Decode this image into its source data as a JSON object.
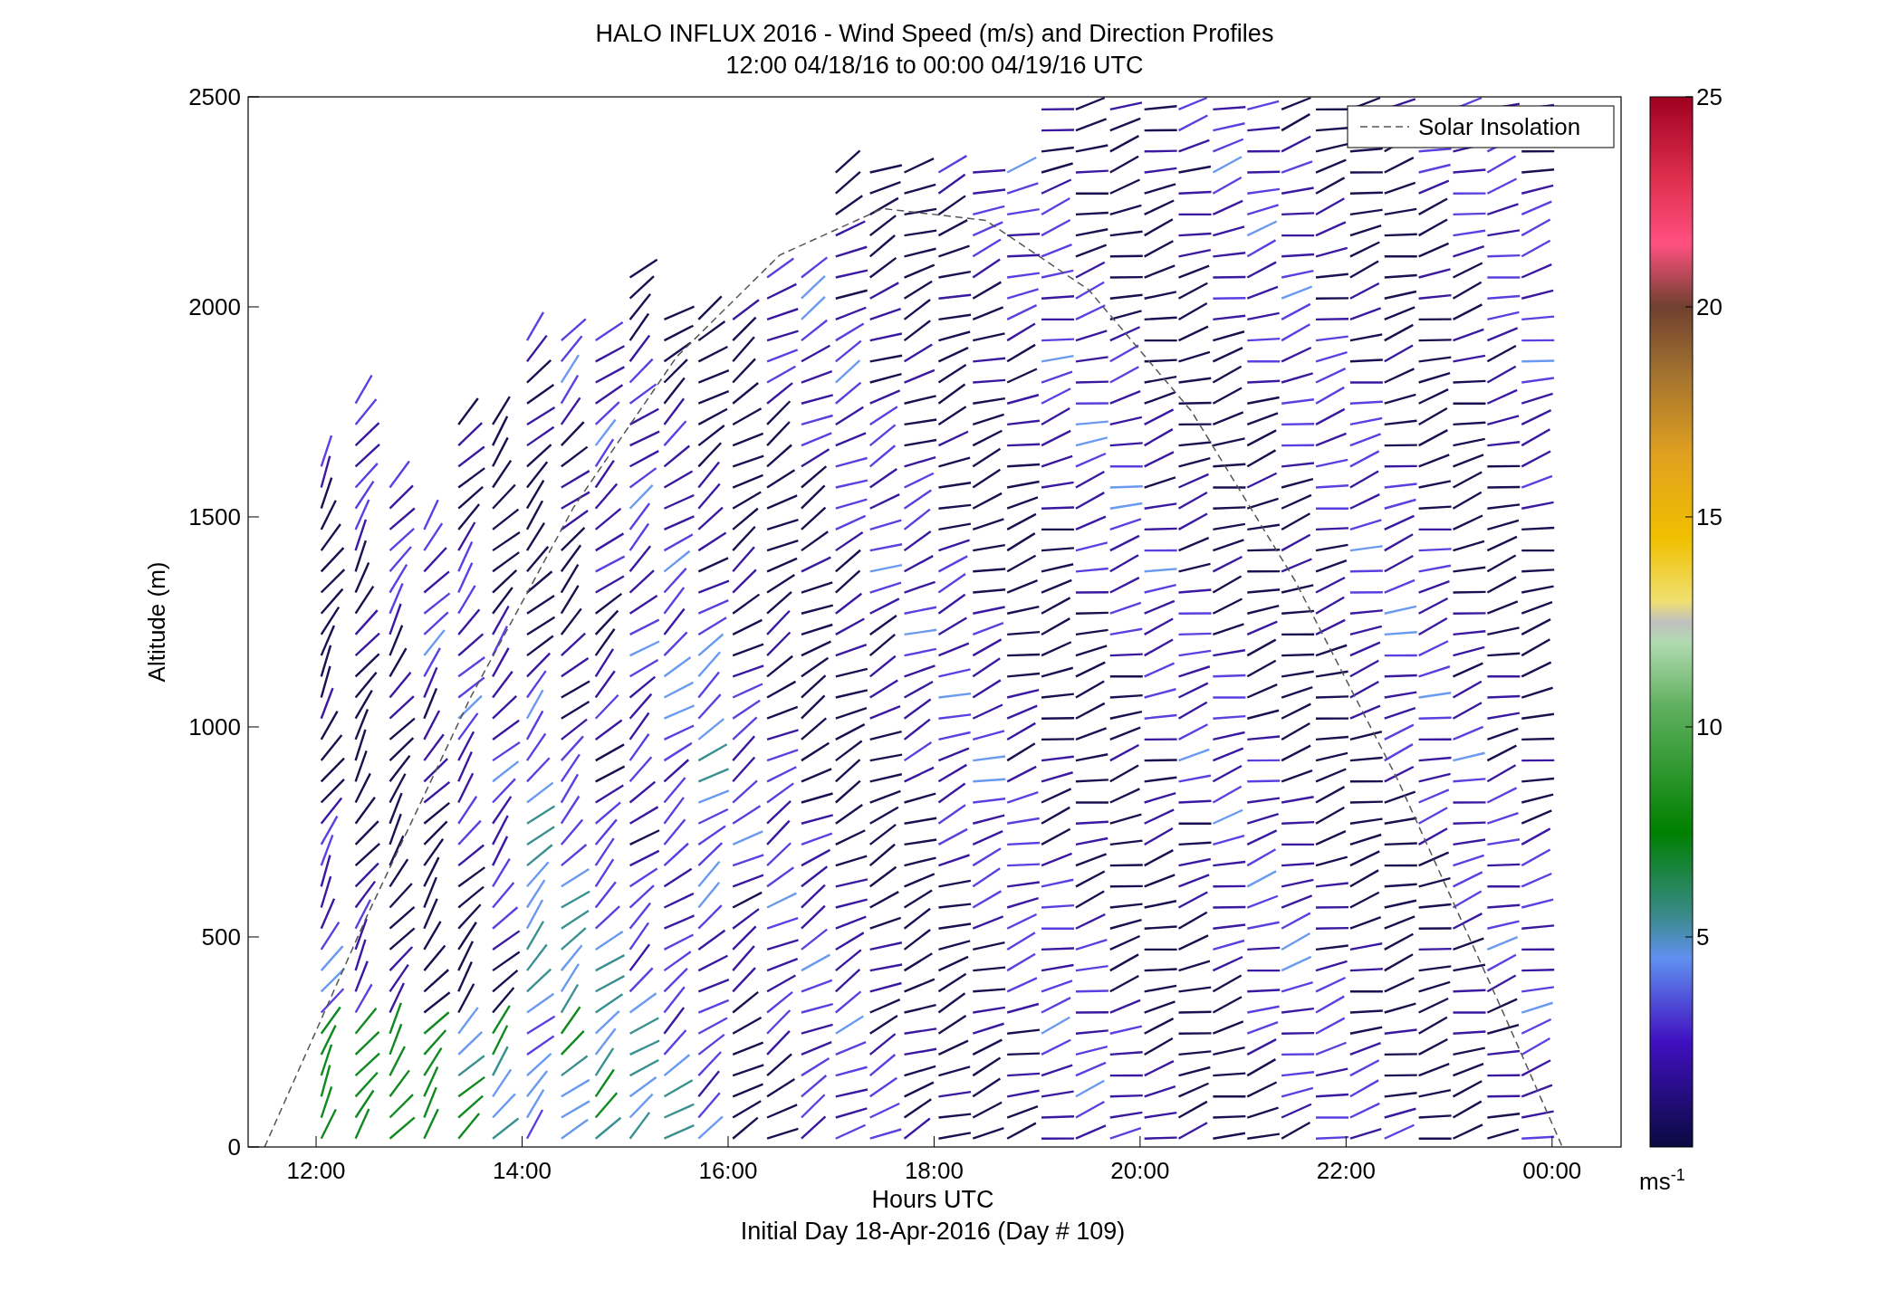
{
  "title": [
    "HALO INFLUX 2016 - Wind Speed (m/s) and Direction Profiles",
    "12:00 04/18/16 to 00:00 04/19/16  UTC"
  ],
  "plot": {
    "subtitle": "Initial Day 18-Apr-2016 (Day # 109)",
    "chart_data": {
      "type": "line",
      "xlabel": "Hours UTC",
      "ylabel": "Altitude (m)",
      "x": [
        11.5,
        12.5,
        13.5,
        14.5,
        15.5,
        16.5,
        17.5,
        18.5,
        19.5,
        20.5,
        21.5,
        22.5,
        23.5,
        24.1
      ],
      "series": [
        {
          "name": "Solar Insolation",
          "color": "#555555",
          "line_style": "dashed",
          "values": [
            0,
            553,
            1071,
            1523,
            1881,
            2123,
            2234,
            2206,
            2041,
            1751,
            1350,
            875,
            334,
            0
          ]
        }
      ],
      "xlim": [
        11.34,
        24.67
      ],
      "ylim": [
        0,
        2500
      ],
      "xticks": [
        {
          "value": 12,
          "label": "12:00"
        },
        {
          "value": 14,
          "label": "14:00"
        },
        {
          "value": 16,
          "label": "16:00"
        },
        {
          "value": 18,
          "label": "18:00"
        },
        {
          "value": 20,
          "label": "20:00"
        },
        {
          "value": 22,
          "label": "22:00"
        },
        {
          "value": 24,
          "label": "00:00"
        }
      ],
      "yticks": [
        0,
        500,
        1000,
        1500,
        2000,
        2500
      ]
    }
  },
  "colorbar": {
    "ticks": [
      "25",
      "20",
      "15",
      "10",
      "5"
    ],
    "unit": "ms",
    "unit_exponent": "-1"
  }
}
